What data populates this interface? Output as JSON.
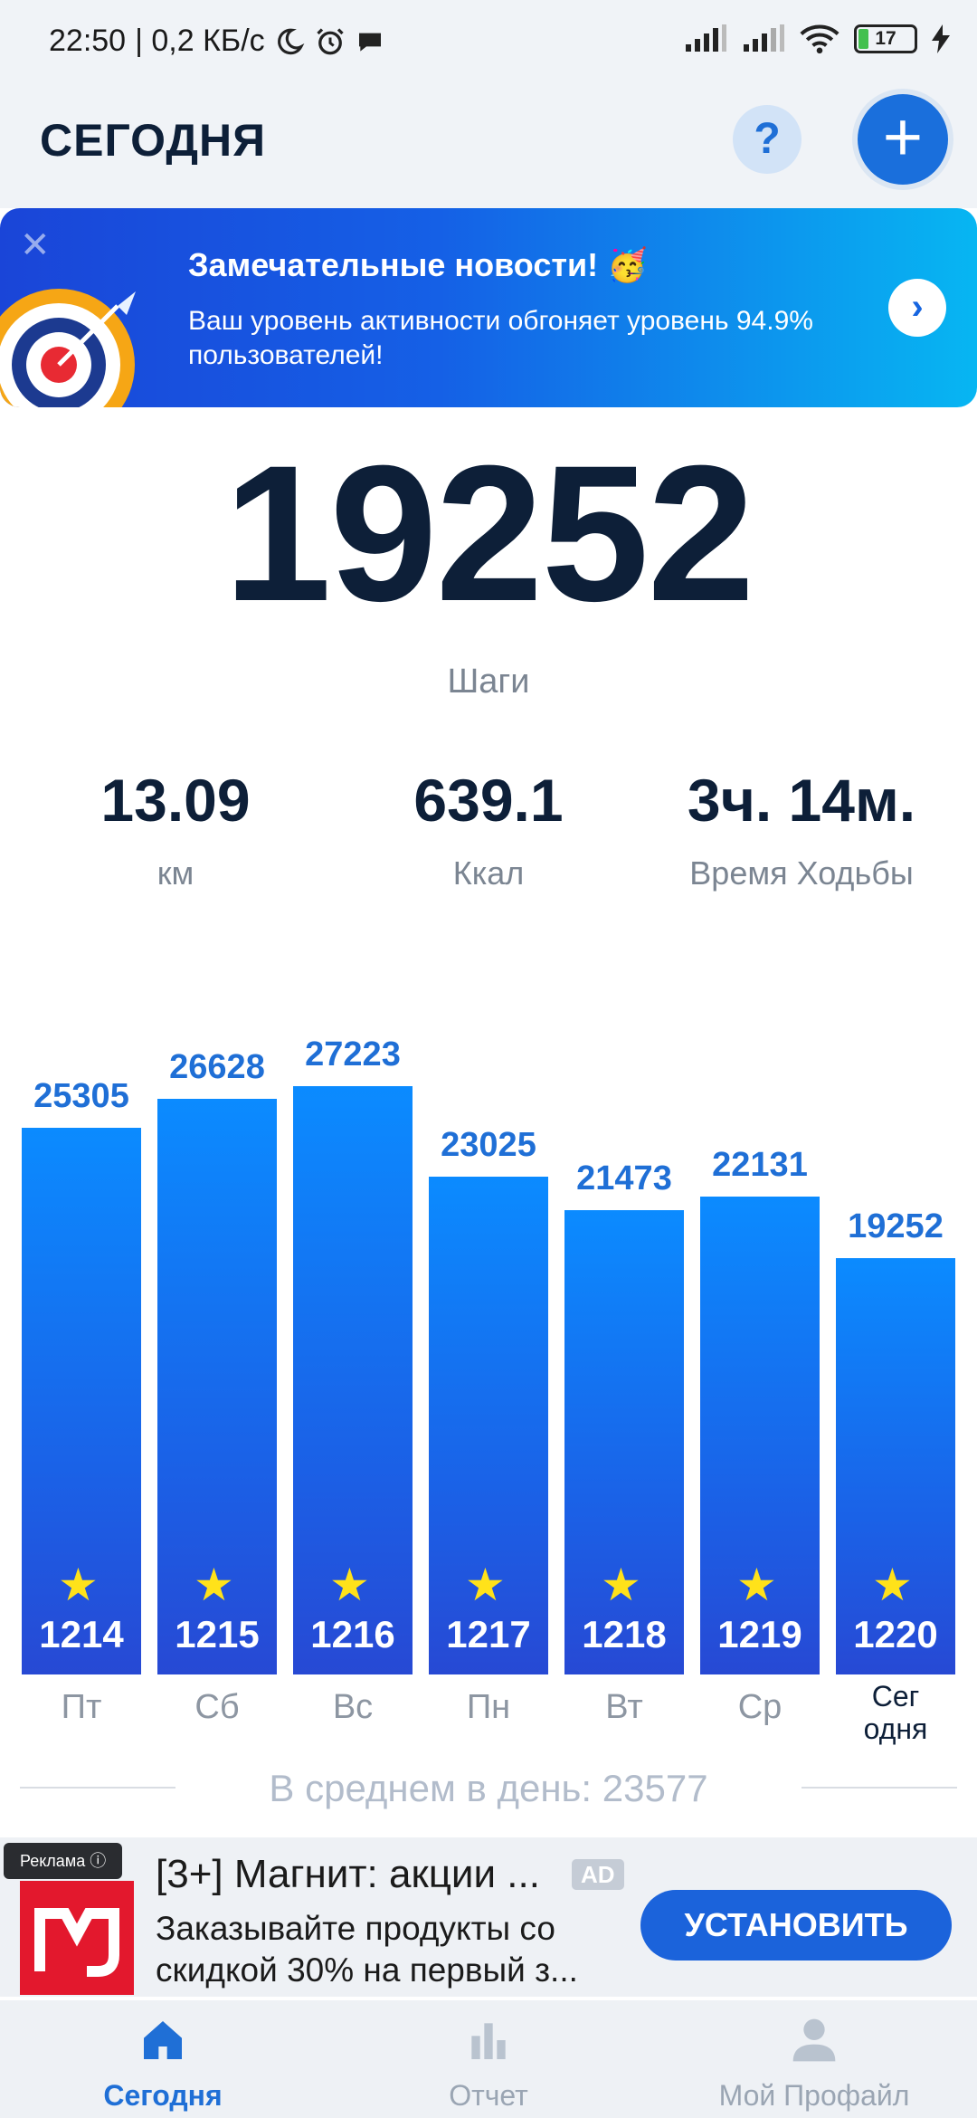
{
  "status_bar": {
    "time": "22:50",
    "speed": "| 0,2 КБ/с",
    "battery_level": "17"
  },
  "header": {
    "title": "СЕГОДНЯ",
    "help_label": "?",
    "add_label": "+"
  },
  "banner": {
    "title": "Замечательные новости! 🥳",
    "text": "Ваш уровень активности обгоняет уровень 94.9% пользователей!",
    "arrow": "›",
    "close": "✕"
  },
  "steps": {
    "value": "19252",
    "label": "Шаги"
  },
  "stats": [
    {
      "value": "13.09",
      "label": "км"
    },
    {
      "value": "639.1",
      "label": "Ккал"
    },
    {
      "value": "3ч. 14м.",
      "label": "Время Ходьбы"
    }
  ],
  "chart_data": {
    "type": "bar",
    "categories": [
      "Пт",
      "Сб",
      "Вс",
      "Пн",
      "Вт",
      "Ср",
      "Сег одня"
    ],
    "values": [
      25305,
      26628,
      27223,
      23025,
      21473,
      22131,
      19252
    ],
    "goal_numbers": [
      "1214",
      "1215",
      "1216",
      "1217",
      "1218",
      "1219",
      "1220"
    ],
    "average_text": "В среднем в день: 23577"
  },
  "ad": {
    "tag": "Реклама ⓘ",
    "title": "[3+] Магнит: акции ...",
    "badge": "AD",
    "text": "Заказывайте продукты со скидкой 30% на первый з...",
    "install_label": "УСТАНОВИТЬ"
  },
  "nav": [
    {
      "label": "Сегодня",
      "icon": "home-icon"
    },
    {
      "label": "Отчет",
      "icon": "bar-chart-icon"
    },
    {
      "label": "Мой Профайл",
      "icon": "profile-icon"
    }
  ]
}
